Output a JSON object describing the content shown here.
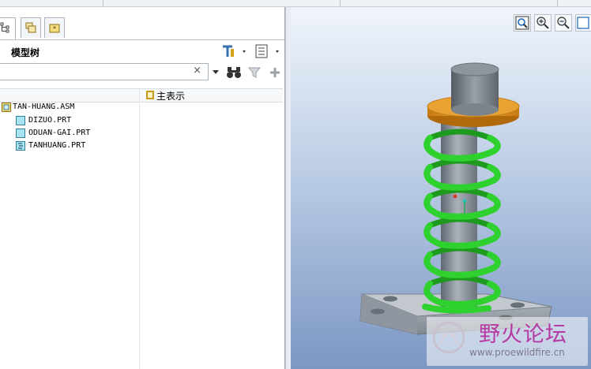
{
  "top_strip": {
    "peek_labels": [
      "",
      "",
      ""
    ]
  },
  "left_panel": {
    "tabs": [
      {
        "name": "model-tree-tab"
      },
      {
        "name": "folder-browser-tab"
      },
      {
        "name": "favorites-tab"
      }
    ],
    "tree_title": "模型树",
    "search": {
      "value": "",
      "clear_glyph": "×"
    },
    "columns": {
      "display_label": "主表示"
    },
    "tree_items": [
      {
        "label": "TAN-HUANG.ASM",
        "kind": "assembly"
      },
      {
        "label": "DIZUO.PRT",
        "kind": "part"
      },
      {
        "label": "ODUAN-GAI.PRT",
        "kind": "part"
      },
      {
        "label": "TANHUANG.PRT",
        "kind": "part-spring"
      }
    ]
  },
  "viewport": {
    "buttons": [
      "refit-zoom",
      "zoom-in",
      "zoom-out",
      "view-box"
    ],
    "colors": {
      "spring": "#2ed12e",
      "cap": "#e89a26",
      "shaft": "#8c949e",
      "base": "#a2a9b2"
    }
  },
  "watermark": {
    "text_cn": "野火论坛",
    "url": "www.proewildfire.cn"
  }
}
